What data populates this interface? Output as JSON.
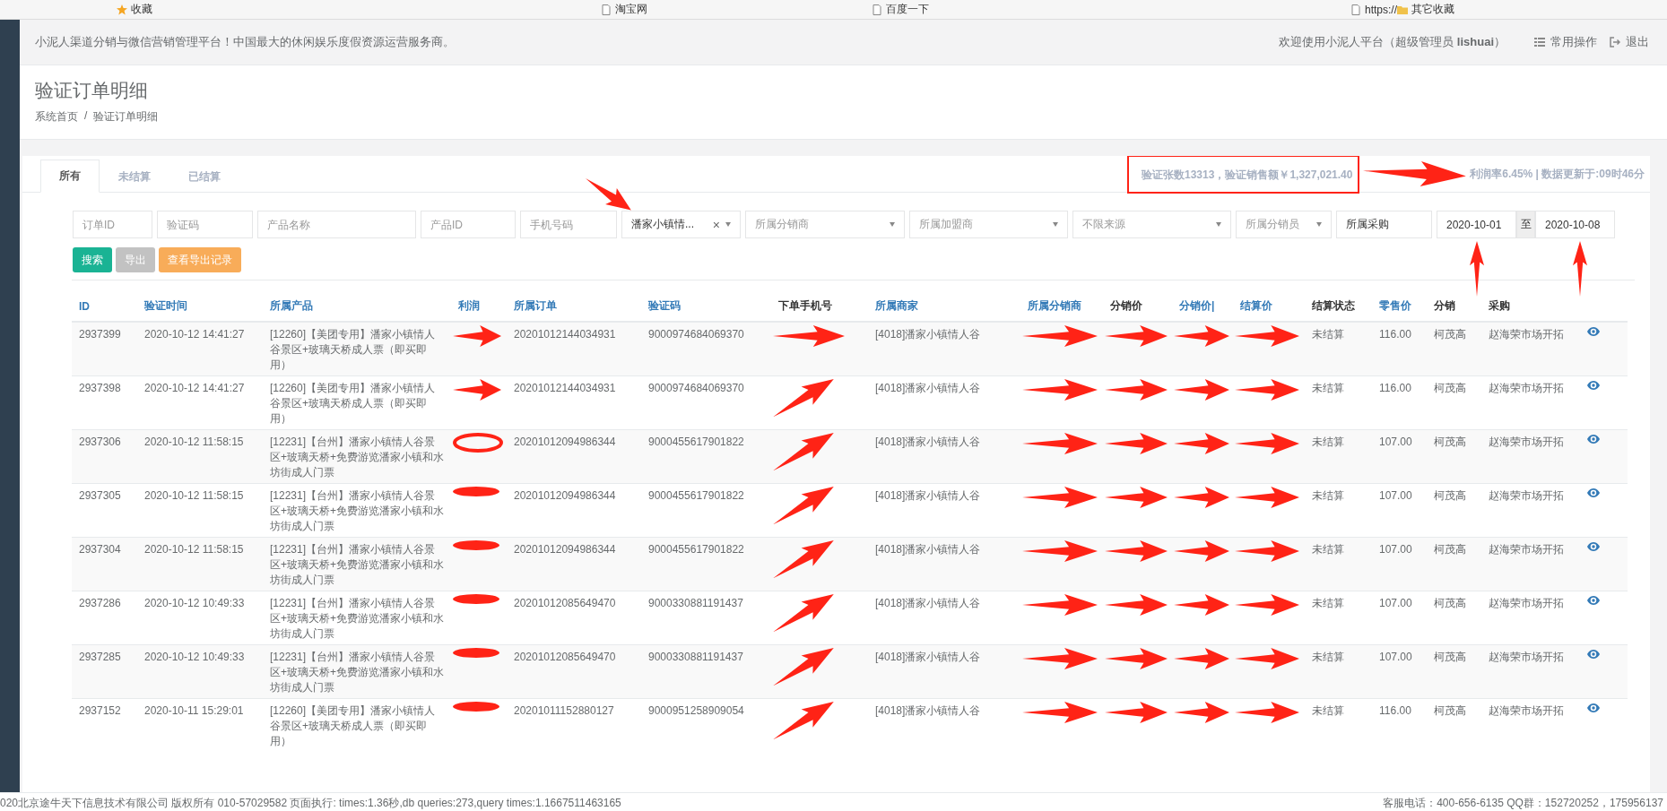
{
  "bookmarks": [
    {
      "label": "收藏",
      "kind": "star"
    },
    {
      "label": "淘宝网",
      "kind": "page"
    },
    {
      "label": "百度一下",
      "kind": "page"
    },
    {
      "label": "https://",
      "kind": "page"
    },
    {
      "label": "其它收藏",
      "kind": "folder"
    }
  ],
  "header": {
    "slogan": "小泥人渠道分销与微信营销管理平台！中国最大的休闲娱乐度假资源运营服务商。",
    "welcome": "欢迎使用小泥人平台（超级管理员 **lishuai**）",
    "links": [
      {
        "label": "常用操作",
        "kind": "list"
      },
      {
        "label": "退出",
        "kind": "signout"
      }
    ]
  },
  "page": {
    "title": "验证订单明细",
    "breadcrumb": [
      {
        "label": "系统首页"
      },
      {
        "label": "验证订单明细"
      }
    ],
    "breadcrumb_separator": "/"
  },
  "tabs": [
    {
      "label": "所有",
      "selected": true
    },
    {
      "label": "未结算",
      "selected": false
    },
    {
      "label": "已结算",
      "selected": false
    }
  ],
  "stats": {
    "summary": "验证张数13313，验证销售额￥1,327,021.40",
    "highlighted": true,
    "detail": "利润率6.45% | 数据更新于:09时46分"
  },
  "filters": [
    {
      "kind": "input",
      "placeholder": "订单ID"
    },
    {
      "kind": "input",
      "placeholder": "验证码"
    },
    {
      "kind": "input",
      "placeholder": "产品名称"
    },
    {
      "kind": "input",
      "placeholder": "产品ID"
    },
    {
      "kind": "input",
      "placeholder": "手机号码"
    },
    {
      "kind": "select",
      "value": "潘家小镇情...",
      "clear": "×",
      "marked": true
    },
    {
      "kind": "select",
      "placeholder": "所属分销商"
    },
    {
      "kind": "select",
      "placeholder": "所属加盟商"
    },
    {
      "kind": "select",
      "placeholder": "不限来源"
    },
    {
      "kind": "select",
      "placeholder": "所属分销员"
    },
    {
      "kind": "input",
      "value": "所属采购"
    },
    {
      "kind": "date",
      "value": "2020-10-01",
      "marked": true
    },
    {
      "kind": "separator",
      "text": "至"
    },
    {
      "kind": "date",
      "value": "2020-10-08",
      "marked": true
    }
  ],
  "buttons": [
    {
      "label": "搜索",
      "kind": "primary"
    },
    {
      "label": "导出",
      "kind": "muted"
    },
    {
      "label": "查看导出记录",
      "kind": "warning"
    }
  ],
  "table": {
    "columns": [
      {
        "label": "ID",
        "sortable": true
      },
      {
        "label": "验证时间",
        "sortable": true
      },
      {
        "label": "所属产品",
        "sortable": true
      },
      {
        "label": "利润",
        "sortable": true
      },
      {
        "label": "所属订单",
        "sortable": true
      },
      {
        "label": "验证码",
        "sortable": true
      },
      {
        "label": "下单手机号",
        "sortable": false
      },
      {
        "label": "所属商家",
        "sortable": true
      },
      {
        "label": "所属分销商",
        "sortable": true
      },
      {
        "label": "分销价",
        "sortable": false
      },
      {
        "label": "分销价|",
        "sortable": true
      },
      {
        "label": "结算价",
        "sortable": true
      },
      {
        "label": "结算状态",
        "sortable": false
      },
      {
        "label": "零售价",
        "sortable": true
      },
      {
        "label": "分销",
        "sortable": false
      },
      {
        "label": "采购",
        "sortable": false
      }
    ],
    "rows": [
      {
        "id": "2937399",
        "time": "2020-10-12 14:41:27",
        "product": "[12260]【美团专用】潘家小镇情人谷景区+玻璃天桥成人票（即买即用）",
        "order": "20201012144034931",
        "code": "9000974684069370",
        "merchant": "[4018]潘家小镇情人谷",
        "status": "未结算",
        "retail": "116.00",
        "seller": "柯茂高",
        "buyer": "赵海荣市场开拓",
        "marks": [
          {
            "kind": "arrow"
          },
          {
            "kind": "arrow"
          },
          {
            "kind": "arrow"
          },
          {
            "kind": "arrow"
          },
          {
            "kind": "arrow"
          },
          {
            "kind": "arrow"
          }
        ]
      },
      {
        "id": "2937398",
        "time": "2020-10-12 14:41:27",
        "product": "[12260]【美团专用】潘家小镇情人谷景区+玻璃天桥成人票（即买即用）",
        "order": "20201012144034931",
        "code": "9000974684069370",
        "merchant": "[4018]潘家小镇情人谷",
        "status": "未结算",
        "retail": "116.00",
        "seller": "柯茂高",
        "buyer": "赵海荣市场开拓",
        "marks": [
          {
            "kind": "arrow"
          },
          {
            "kind": "diagonal"
          },
          {
            "kind": "arrow"
          },
          {
            "kind": "arrow"
          },
          {
            "kind": "arrow"
          },
          {
            "kind": "arrow"
          }
        ]
      },
      {
        "id": "2937306",
        "time": "2020-10-12 11:58:15",
        "product": "[12231]【台州】潘家小镇情人谷景区+玻璃天桥+免费游览潘家小镇和水坊街成人门票",
        "order": "20201012094986344",
        "code": "9000455617901822",
        "merchant": "[4018]潘家小镇情人谷",
        "status": "未结算",
        "retail": "107.00",
        "seller": "柯茂高",
        "buyer": "赵海荣市场开拓",
        "marks": [
          {
            "kind": "ring"
          },
          {
            "kind": "diagonal"
          },
          {
            "kind": "arrow"
          },
          {
            "kind": "arrow"
          },
          {
            "kind": "arrow"
          },
          {
            "kind": "arrow"
          }
        ]
      },
      {
        "id": "2937305",
        "time": "2020-10-12 11:58:15",
        "product": "[12231]【台州】潘家小镇情人谷景区+玻璃天桥+免费游览潘家小镇和水坊街成人门票",
        "order": "20201012094986344",
        "code": "9000455617901822",
        "merchant": "[4018]潘家小镇情人谷",
        "status": "未结算",
        "retail": "107.00",
        "seller": "柯茂高",
        "buyer": "赵海荣市场开拓",
        "marks": [
          {
            "kind": "blot"
          },
          {
            "kind": "diagonal"
          },
          {
            "kind": "arrow"
          },
          {
            "kind": "arrow"
          },
          {
            "kind": "arrow"
          },
          {
            "kind": "arrow"
          }
        ]
      },
      {
        "id": "2937304",
        "time": "2020-10-12 11:58:15",
        "product": "[12231]【台州】潘家小镇情人谷景区+玻璃天桥+免费游览潘家小镇和水坊街成人门票",
        "order": "20201012094986344",
        "code": "9000455617901822",
        "merchant": "[4018]潘家小镇情人谷",
        "status": "未结算",
        "retail": "107.00",
        "seller": "柯茂高",
        "buyer": "赵海荣市场开拓",
        "marks": [
          {
            "kind": "blot"
          },
          {
            "kind": "diagonal"
          },
          {
            "kind": "arrow"
          },
          {
            "kind": "arrow"
          },
          {
            "kind": "arrow"
          },
          {
            "kind": "arrow"
          }
        ]
      },
      {
        "id": "2937286",
        "time": "2020-10-12 10:49:33",
        "product": "[12231]【台州】潘家小镇情人谷景区+玻璃天桥+免费游览潘家小镇和水坊街成人门票",
        "order": "20201012085649470",
        "code": "9000330881191437",
        "merchant": "[4018]潘家小镇情人谷",
        "status": "未结算",
        "retail": "107.00",
        "seller": "柯茂高",
        "buyer": "赵海荣市场开拓",
        "marks": [
          {
            "kind": "blot"
          },
          {
            "kind": "diagonal"
          },
          {
            "kind": "arrow"
          },
          {
            "kind": "arrow"
          },
          {
            "kind": "arrow"
          },
          {
            "kind": "arrow"
          }
        ]
      },
      {
        "id": "2937285",
        "time": "2020-10-12 10:49:33",
        "product": "[12231]【台州】潘家小镇情人谷景区+玻璃天桥+免费游览潘家小镇和水坊街成人门票",
        "order": "20201012085649470",
        "code": "9000330881191437",
        "merchant": "[4018]潘家小镇情人谷",
        "status": "未结算",
        "retail": "107.00",
        "seller": "柯茂高",
        "buyer": "赵海荣市场开拓",
        "marks": [
          {
            "kind": "blot"
          },
          {
            "kind": "diagonal"
          },
          {
            "kind": "arrow"
          },
          {
            "kind": "arrow"
          },
          {
            "kind": "arrow"
          },
          {
            "kind": "arrow"
          }
        ]
      },
      {
        "id": "2937152",
        "time": "2020-10-11 15:29:01",
        "product": "[12260]【美团专用】潘家小镇情人谷景区+玻璃天桥成人票（即买即用）",
        "order": "20201011152880127",
        "code": "9000951258909054",
        "merchant": "[4018]潘家小镇情人谷",
        "status": "未结算",
        "retail": "116.00",
        "seller": "柯茂高",
        "buyer": "赵海荣市场开拓",
        "marks": [
          {
            "kind": "blot"
          },
          {
            "kind": "diagonal"
          },
          {
            "kind": "arrow"
          },
          {
            "kind": "arrow"
          },
          {
            "kind": "arrow"
          },
          {
            "kind": "arrow"
          }
        ]
      }
    ]
  },
  "footer": {
    "left": "020北京途牛天下信息技术有限公司 版权所有 010-57029582 页面执行: times:1.36秒,db queries:273,query times:1.1667511463165",
    "right": "客服电话：400-656-6135 QQ群：152720252，175956137"
  }
}
